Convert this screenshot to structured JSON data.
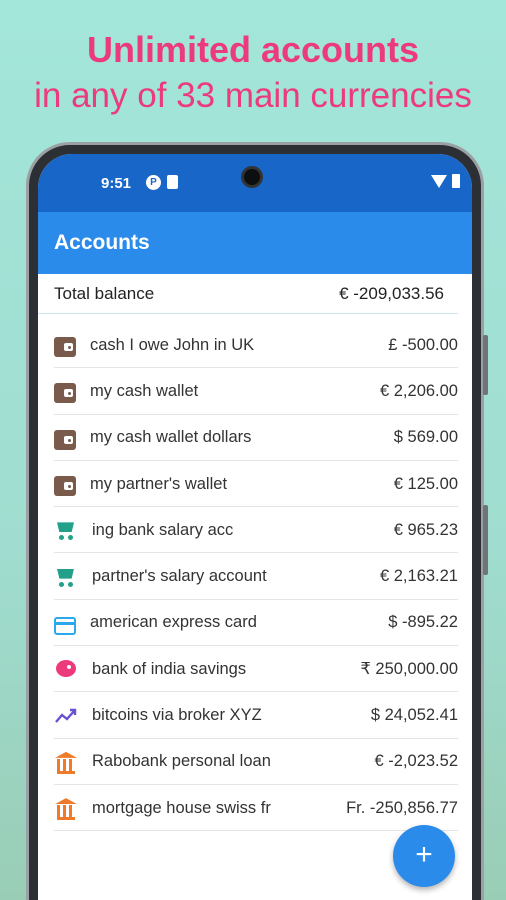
{
  "promo": {
    "headline": "Unlimited accounts",
    "subline": "in any of 33 main currencies"
  },
  "statusbar": {
    "time": "9:51"
  },
  "appbar": {
    "title": "Accounts"
  },
  "total": {
    "label": "Total balance",
    "value": "€ -209,033.56"
  },
  "accounts": [
    {
      "name": "cash I owe John in UK",
      "amount": "£ -500.00",
      "icon": "wallet-icon"
    },
    {
      "name": "my cash wallet",
      "amount": "€ 2,206.00",
      "icon": "wallet-icon"
    },
    {
      "name": "my cash wallet dollars",
      "amount": "$ 569.00",
      "icon": "wallet-icon"
    },
    {
      "name": "my partner's wallet",
      "amount": "€ 125.00",
      "icon": "wallet-icon"
    },
    {
      "name": "ing bank salary acc",
      "amount": "€ 965.23",
      "icon": "cart-icon"
    },
    {
      "name": "partner's salary account",
      "amount": "€ 2,163.21",
      "icon": "cart-icon"
    },
    {
      "name": "american express card",
      "amount": "$ -895.22",
      "icon": "credit-card-icon"
    },
    {
      "name": "bank of india savings",
      "amount": "₹ 250,000.00",
      "icon": "piggy-bank-icon"
    },
    {
      "name": "bitcoins via broker XYZ",
      "amount": "$ 24,052.41",
      "icon": "trending-up-icon"
    },
    {
      "name": "Rabobank personal loan",
      "amount": "€ -2,023.52",
      "icon": "bank-icon"
    },
    {
      "name": "mortgage house swiss fr",
      "amount": "Fr. -250,856.77",
      "icon": "bank-icon"
    }
  ],
  "fab": {
    "label": "+"
  },
  "colors": {
    "accent_pink": "#ec3a7c",
    "appbar_blue": "#2a8bea",
    "statusbar_blue": "#1766c8",
    "background_mint": "#a3e6da"
  }
}
